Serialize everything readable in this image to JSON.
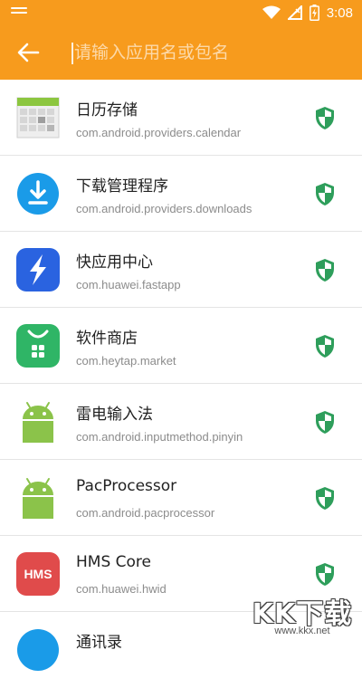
{
  "status": {
    "time": "3:08"
  },
  "search": {
    "placeholder": "请输入应用名或包名",
    "value": ""
  },
  "apps": [
    {
      "name": "日历存储",
      "package": "com.android.providers.calendar",
      "icon": "calendar-storage-icon"
    },
    {
      "name": "下载管理程序",
      "package": "com.android.providers.downloads",
      "icon": "download-icon"
    },
    {
      "name": "快应用中心",
      "package": "com.huawei.fastapp",
      "icon": "fastapp-lightning-icon"
    },
    {
      "name": "软件商店",
      "package": "com.heytap.market",
      "icon": "market-bag-icon"
    },
    {
      "name": "雷电输入法",
      "package": "com.android.inputmethod.pinyin",
      "icon": "android-robot-icon"
    },
    {
      "name": "PacProcessor",
      "package": "com.android.pacprocessor",
      "icon": "android-robot-icon"
    },
    {
      "name": "HMS Core",
      "package": "com.huawei.hwid",
      "icon": "hms-icon"
    },
    {
      "name": "通讯录",
      "package": "",
      "icon": "contacts-icon"
    }
  ],
  "icon_labels": {
    "hms": "HMS"
  },
  "watermark": {
    "text": "KK下载",
    "url": "www.kkx.net"
  },
  "colors": {
    "accent": "#f79b1d",
    "shield": "#2e9e5b",
    "download_blue": "#1a9be8",
    "fastapp_blue": "#2a63e0",
    "market_green": "#2fb566",
    "android_green": "#8bc34a",
    "hms_red": "#e04b4b"
  }
}
